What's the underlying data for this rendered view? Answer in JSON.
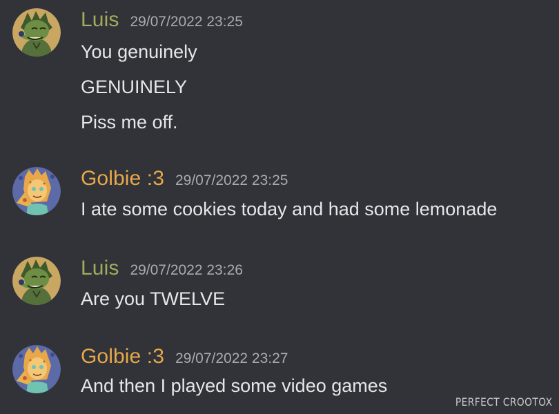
{
  "colors": {
    "background": "#313338",
    "luis_name": "#a3ab5c",
    "golbie_name": "#e8a84a",
    "timestamp": "#a9abb0",
    "text": "#e6e7e9"
  },
  "messages": [
    {
      "author": "Luis",
      "avatar_icon": "green-wolf-avatar-icon",
      "timestamp": "29/07/2022 23:25",
      "lines": [
        "You genuinely",
        "GENUINELY",
        "Piss me off."
      ]
    },
    {
      "author": "Golbie :3",
      "avatar_icon": "orange-cat-pizza-avatar-icon",
      "timestamp": "29/07/2022 23:25",
      "lines": [
        "I ate some cookies today and had some lemonade"
      ]
    },
    {
      "author": "Luis",
      "avatar_icon": "green-wolf-avatar-icon",
      "timestamp": "29/07/2022 23:26",
      "lines": [
        "Are you TWELVE"
      ]
    },
    {
      "author": "Golbie :3",
      "avatar_icon": "orange-cat-pizza-avatar-icon",
      "timestamp": "29/07/2022 23:27",
      "lines": [
        "And then I played some video games"
      ]
    }
  ],
  "watermark": "PERFECT CROOTOX"
}
